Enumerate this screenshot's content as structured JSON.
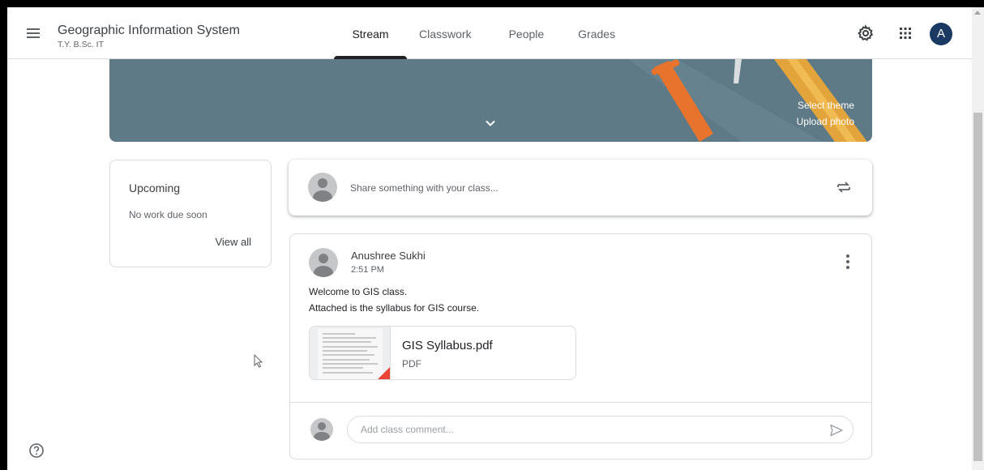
{
  "header": {
    "class_title": "Geographic Information System",
    "class_subtitle": "T.Y. B.Sc. IT",
    "menu_icon": "hamburger-menu-icon",
    "settings_icon": "gear-icon",
    "apps_icon": "apps-grid-icon",
    "account_initial": "A",
    "tabs": [
      {
        "label": "Stream",
        "active": true
      },
      {
        "label": "Classwork",
        "active": false
      },
      {
        "label": "People",
        "active": false
      },
      {
        "label": "Grades",
        "active": false
      }
    ]
  },
  "banner": {
    "select_theme": "Select theme",
    "upload_photo": "Upload photo",
    "color": "#5f7a87"
  },
  "upcoming": {
    "title": "Upcoming",
    "empty_text": "No work due soon",
    "view_all": "View all"
  },
  "share": {
    "placeholder": "Share something with your class..."
  },
  "post": {
    "author": "Anushree Sukhi",
    "time": "2:51 PM",
    "lines": [
      "Welcome to GIS class.",
      "Attached is the syllabus for GIS course."
    ],
    "attachment": {
      "name": "GIS Syllabus.pdf",
      "type": "PDF"
    },
    "comment_placeholder": "Add class comment..."
  },
  "colors": {
    "text": "#3c4043",
    "muted": "#5f6368",
    "border": "#dadce0",
    "avatar_bg": "#1a3a63",
    "pdf_red": "#ea4335"
  }
}
